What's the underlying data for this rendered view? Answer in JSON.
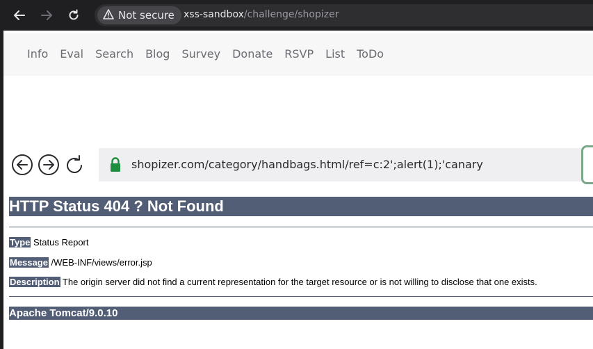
{
  "browser": {
    "security_label": "Not secure",
    "url_host": "xss-sandbox",
    "url_path": "/challenge/shopizer"
  },
  "site_nav": {
    "items": [
      "Info",
      "Eval",
      "Search",
      "Blog",
      "Survey",
      "Donate",
      "RSVP",
      "List",
      "ToDo"
    ]
  },
  "inner_browser": {
    "url": "shopizer.com/category/handbags.html/ref=c:2';alert(1);'canary"
  },
  "error_page": {
    "title": "HTTP Status 404 ? Not Found",
    "type_label": "Type",
    "type_value": "Status Report",
    "message_label": "Message",
    "message_value": "/WEB-INF/views/error.jsp",
    "description_label": "Description",
    "description_value": "The origin server did not find a current representation for the target resource or is not willing to disclose that one exists.",
    "server": "Apache Tomcat/9.0.10"
  },
  "colors": {
    "browser_bar": "#1f1f22",
    "tomcat_bar": "#525d76",
    "lock_green": "#1e8e3e"
  }
}
